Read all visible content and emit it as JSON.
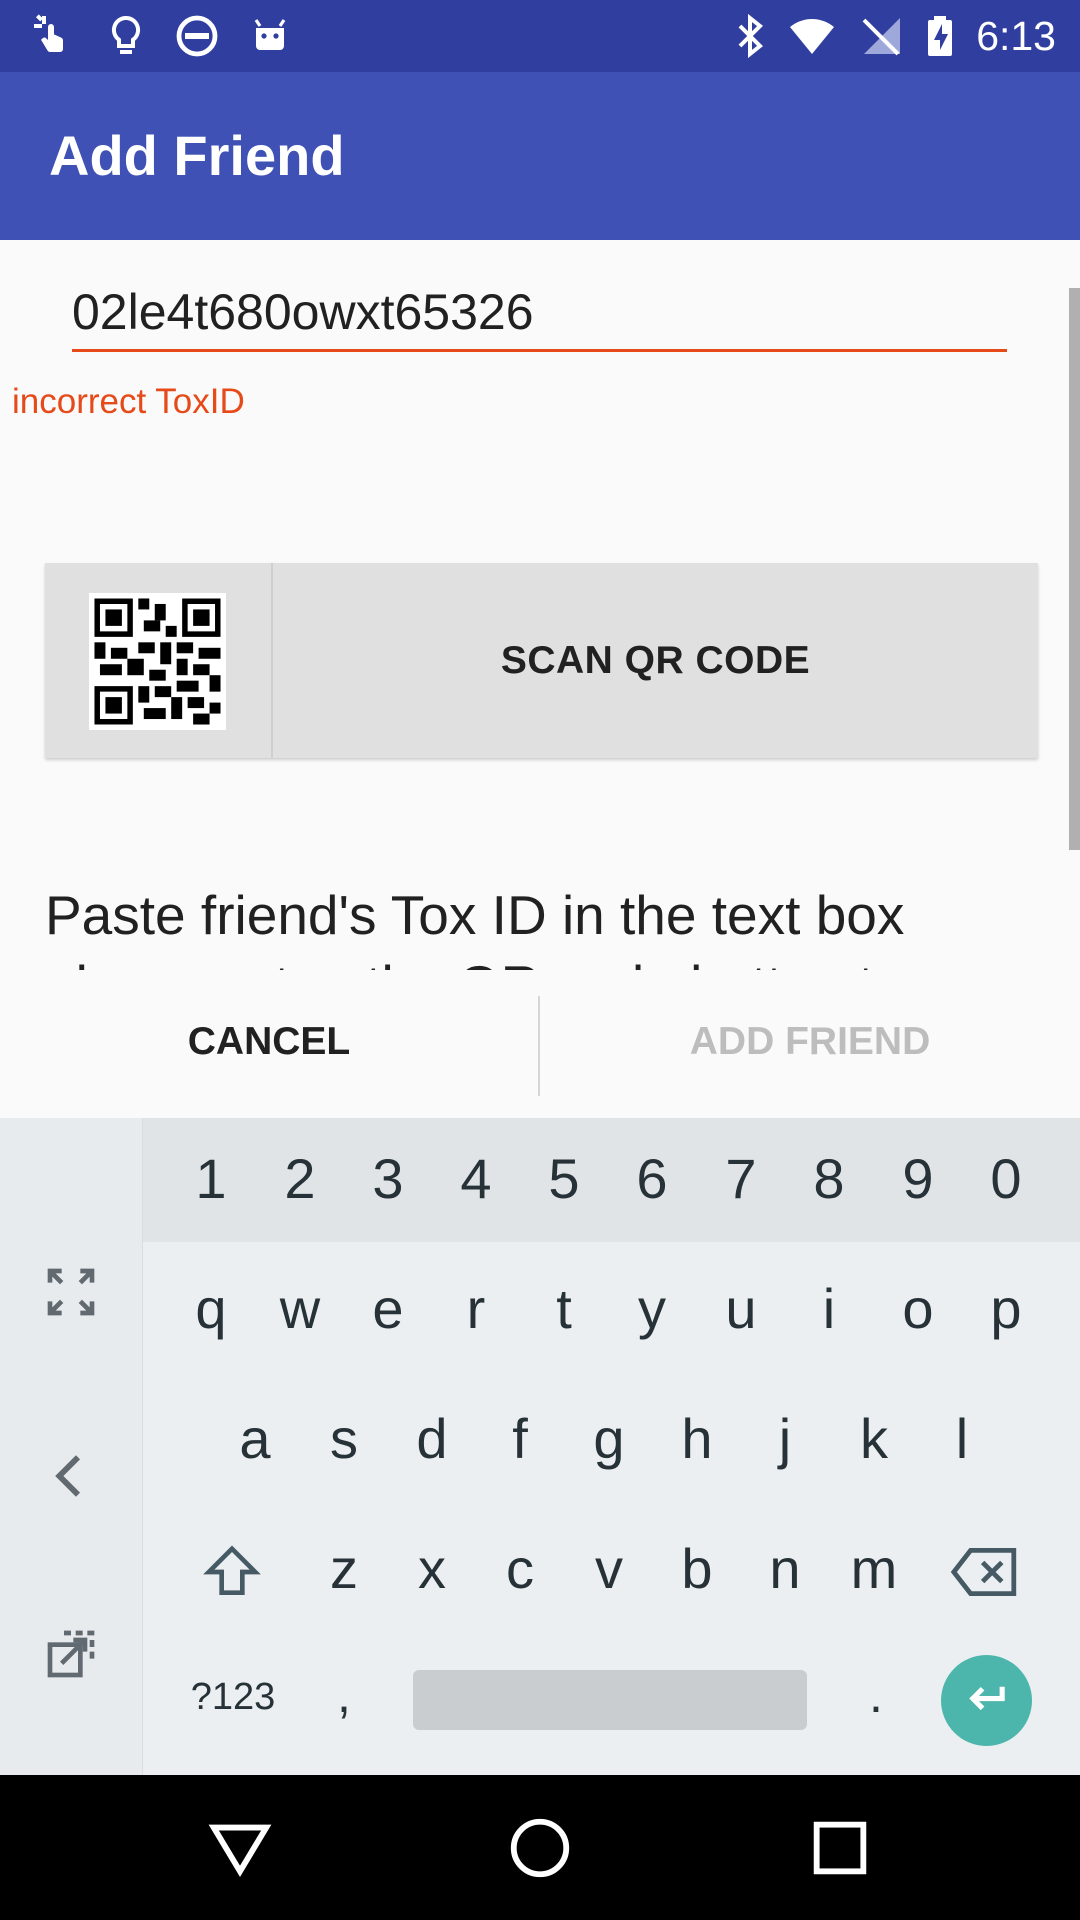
{
  "status_bar": {
    "time": "6:13",
    "left_icons": [
      "touch-app-icon",
      "lightbulb-icon",
      "do-not-disturb-icon",
      "android-icon"
    ],
    "right_icons": [
      "bluetooth-icon",
      "wifi-icon",
      "no-signal-icon",
      "battery-charging-icon"
    ]
  },
  "app_bar": {
    "title": "Add Friend"
  },
  "form": {
    "toxid_value": "02le4t680owxt65326",
    "error_text": "incorrect ToxID",
    "scan_button_label": "SCAN QR CODE",
    "help_text": "Paste friend's Tox ID in the text box above or tap the QR code button to"
  },
  "dialog_actions": {
    "cancel_label": "CANCEL",
    "add_friend_label": "ADD FRIEND",
    "add_friend_enabled": false
  },
  "keyboard": {
    "number_row": [
      "1",
      "2",
      "3",
      "4",
      "5",
      "6",
      "7",
      "8",
      "9",
      "0"
    ],
    "row1": [
      "q",
      "w",
      "e",
      "r",
      "t",
      "y",
      "u",
      "i",
      "o",
      "p"
    ],
    "row2": [
      "a",
      "s",
      "d",
      "f",
      "g",
      "h",
      "j",
      "k",
      "l"
    ],
    "row3": [
      "z",
      "x",
      "c",
      "v",
      "b",
      "n",
      "m"
    ],
    "symbols_label": "?123",
    "comma": ",",
    "period": "."
  },
  "colors": {
    "status_bar": "#303f9f",
    "app_bar": "#3f51b5",
    "error": "#e64a19",
    "enter_key": "#4db6ac"
  }
}
